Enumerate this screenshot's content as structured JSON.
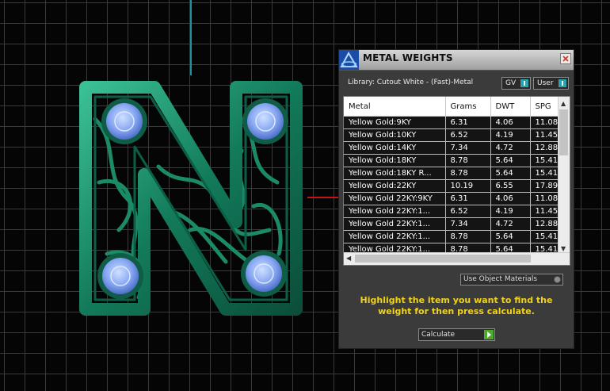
{
  "panel": {
    "title": "METAL WEIGHTS",
    "close_label": "×",
    "library_label": "Library: Cutout White - (Fast)-Metal",
    "toggle_gv": "GV",
    "toggle_user": "User",
    "use_object_materials": "Use Object Materials",
    "instruction": "Highlight the item you want to find the weight for then press calculate.",
    "calculate_label": "Calculate"
  },
  "table": {
    "columns": [
      "Metal",
      "Grams",
      "DWT",
      "SPG"
    ],
    "rows": [
      [
        "Yellow Gold:9KY",
        "6.31",
        "4.06",
        "11.08"
      ],
      [
        "Yellow Gold:10KY",
        "6.52",
        "4.19",
        "11.45"
      ],
      [
        "Yellow Gold:14KY",
        "7.34",
        "4.72",
        "12.88"
      ],
      [
        "Yellow Gold:18KY",
        "8.78",
        "5.64",
        "15.41"
      ],
      [
        "Yellow Gold:18KY R...",
        "8.78",
        "5.64",
        "15.41"
      ],
      [
        "Yellow Gold:22KY",
        "10.19",
        "6.55",
        "17.89"
      ],
      [
        "Yellow Gold 22KY:9KY",
        "6.31",
        "4.06",
        "11.08"
      ],
      [
        "Yellow Gold 22KY:1...",
        "6.52",
        "4.19",
        "11.45"
      ],
      [
        "Yellow Gold 22KY:1...",
        "7.34",
        "4.72",
        "12.88"
      ],
      [
        "Yellow Gold 22KY:1...",
        "8.78",
        "5.64",
        "15.41"
      ],
      [
        "Yellow Gold 22KY:1...",
        "8.78",
        "5.64",
        "15.41"
      ]
    ]
  },
  "icons": {
    "app": "metal-weights-app-icon",
    "close": "close-icon",
    "scroll_up": "chevron-up-icon",
    "scroll_down": "chevron-down-icon",
    "scroll_left": "chevron-left-icon",
    "calculate": "play-icon"
  },
  "colors": {
    "model_green": "#1e8a6a",
    "gem_blue": "#8eaef7",
    "instruction_yellow": "#f1d21b",
    "accent_teal": "#2aa3ad",
    "calc_green": "#4ea829"
  }
}
